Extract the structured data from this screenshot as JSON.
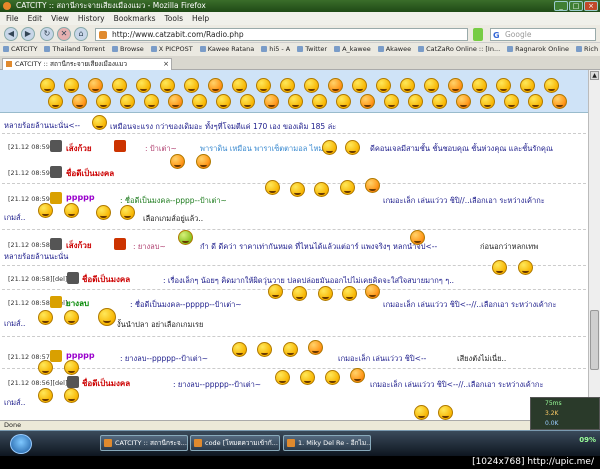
{
  "window": {
    "title": "CATCITY :: สถานีกระจายเสียงเมืองแมว - Mozilla Firefox"
  },
  "menu": [
    "File",
    "Edit",
    "View",
    "History",
    "Bookmarks",
    "Tools",
    "Help"
  ],
  "nav": {
    "url": "http://www.catzabit.com/Radio.php",
    "search_placeholder": "Google"
  },
  "bookmarks": [
    "CATCITY",
    "Thailand Torrent",
    "Browse",
    "X PICPOST",
    "Kawee Ratana",
    "hi5 - A",
    "Twitter",
    "A_kawee",
    "Akawee",
    "CatZaRo Online :: [In...",
    "Ragnarok Online",
    "Rich RO"
  ],
  "tab": {
    "label": "CATCITY :: สถานีกระจายเสียงเมืองแมว",
    "close": "×"
  },
  "chat": [
    {
      "ts": "",
      "nick": "",
      "text": "หลายร้อยล้านนะนั่น<--",
      "text2": "เหมือนจะแรง กว่าของเดิมอะ ทั้งๆที่โจมตีแค่ 170 เอง ของเดิม 185 ล่ะ"
    },
    {
      "ts": "[21.12 08:59]",
      "nick": "เส็งก้วย",
      "text": ": ป้าเต่า~",
      "text2": "พาราดิน เหมือน พาราเซ็ตตามอล ไหม<--",
      "text3": "ดีคอนเจลมีสามชั้น ชั้นชอบคุณ ชั้นห่วงคุณ และชั้นรักคุณ"
    },
    {
      "ts": "[21.12 08:59]",
      "nick": "ชื่อดีเป็นมงคล",
      "text": ""
    },
    {
      "ts": "[21.12 08:59]",
      "nick": "ppppp",
      "text": ": ชื่อดีเป็นมงคล--pppp--ป้าเต่า~",
      "text2": "เกมอะเล็ก เล่นแว่วว ชิปิ//..เลือกเอา ระหว่างเค้ากะ",
      "text3": "เกมส์..",
      "text4": "เลือกเกมส์อยู่แล้ว.."
    },
    {
      "ts": "[21.12 08:58]",
      "nick": "เส็งก้วย",
      "text": ": ยางลบ~",
      "text2": "กำ ดี ดีคว่า ราคาเท่ากันหมด ที่ไหนได้แล้วแต่อาร์ แพงจริงๆ หลกนำจี๊ป<--",
      "text3": "ก่อนอกว่าหลกเทพ",
      "text4": "หลายร้อยล้านนะนั่น"
    },
    {
      "ts": "[21.12 08:58][del]",
      "nick": "ชื่อดีเป็นมงคล",
      "text": ": เรื่องเล็กๆ น้อยๆ คิดมากให้ผิดวุ่นวาย ปลดปล่อยมันออกไปไม่เคยคิดจะใส่ใจสบายมากๆ ๆ.."
    },
    {
      "ts": "[21.12 08:58][del]",
      "nick": "ยางลบ",
      "text": ": ชื่อดีเป็นมงคล--ppppp--ป้าเต่า~",
      "text2": "เกมอะเล็ก เล่นแว่วว ชิปิ<--//..เลือกเอา ระหว่างเค้ากะ",
      "text3": "เกมส์..",
      "text4": "งั้นนำปลา อย่าเลือกเกมเรย"
    },
    {
      "ts": "[21.12 08:57]",
      "nick": "ppppp",
      "text": ": ยางลบ--ppppp--ป้าเต่า~",
      "text2": "เกมอะเล็ก เล่นแว่วว ชิปิ<--",
      "text3": "เสียงตังไม่เนี่ย.."
    },
    {
      "ts": "[21.12 08:56][del]",
      "nick": "ชื่อดีเป็นมงคล",
      "text": ": ยางลบ--ppppp--ป้าเต่า~",
      "text2": "เกมอะเล็ก เล่นแว่วว ชิปิ<--//..เลือกเอา ระหว่างเค้ากะ",
      "text3": "เกมส์.."
    }
  ],
  "status": "Done",
  "widget": {
    "a": "75ms",
    "b": "3.2K",
    "c": "0.0K"
  },
  "taskbar": [
    "CATCITY :: สถานีกระจ...",
    "code [โหมดความเข้ากั...",
    "1. Miky Del Re - อีกไม..."
  ],
  "tray": {
    "battery": "09%"
  },
  "footer": "[1024x768] http://upic.me/"
}
